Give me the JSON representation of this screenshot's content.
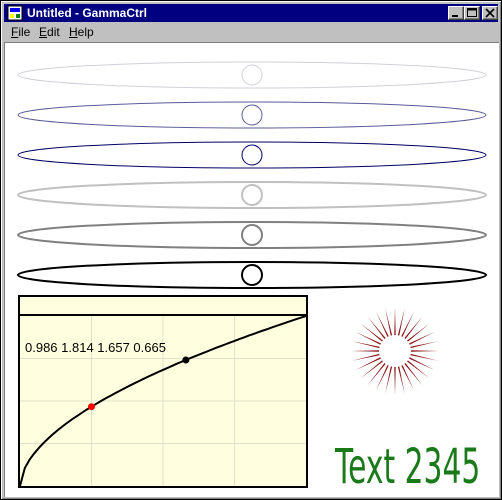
{
  "window": {
    "title": "Untitled - GammaCtrl",
    "controls": {
      "minimize": "0",
      "maximize": "1",
      "close": "r"
    }
  },
  "menu": [
    {
      "accel": "F",
      "rest": "ile"
    },
    {
      "accel": "E",
      "rest": "dit"
    },
    {
      "accel": "H",
      "rest": "elp"
    }
  ],
  "colors": {
    "titlebar": "#000080",
    "panel_bg": "#ffffe0",
    "sunburst": "#8b1a1a",
    "text_sample": "#1a7a1a",
    "control_point_red": "#ff0000",
    "control_point_black": "#000000"
  },
  "ellipse_rows": [
    {
      "stroke": "#d0d0d8",
      "width": 1
    },
    {
      "stroke": "#5a5a9a",
      "width": 1
    },
    {
      "stroke": "#000066",
      "width": 1
    },
    {
      "stroke": "#c0c0c0",
      "width": 2
    },
    {
      "stroke": "#808080",
      "width": 2
    },
    {
      "stroke": "#000000",
      "width": 2
    }
  ],
  "gamma_panel": {
    "readout": "0.986  1.814  1.657  0.665",
    "curve_exponent": 0.55,
    "control_points": [
      {
        "x": 0.25,
        "color": "#ff0000"
      },
      {
        "x": 0.58,
        "color": "#000000"
      }
    ]
  },
  "sample_text": "Text 2345"
}
